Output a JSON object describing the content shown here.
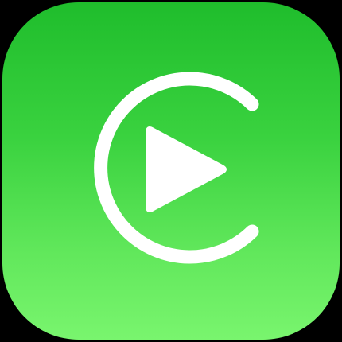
{
  "app_icon": {
    "name": "",
    "glyph_icon": "carplay-play-icon",
    "colors": {
      "background": "#000000",
      "gradient_top": "#1fbd2c",
      "gradient_bottom": "#79f56e",
      "glyph": "#ffffff"
    }
  }
}
